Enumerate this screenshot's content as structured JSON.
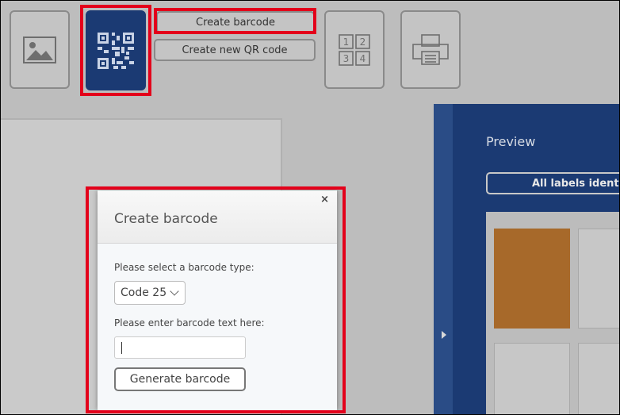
{
  "toolbar": {
    "create_barcode_label": "Create barcode",
    "create_qr_label": "Create new QR code",
    "tools": [
      {
        "name": "image-icon"
      },
      {
        "name": "qr-code-icon"
      },
      {
        "name": "label-order-icon",
        "digits": [
          "1",
          "2",
          "3",
          "4"
        ]
      },
      {
        "name": "print-layout-icon"
      }
    ]
  },
  "preview": {
    "title": "Preview",
    "all_labels_button": "All labels identical"
  },
  "dialog": {
    "title": "Create barcode",
    "close": "×",
    "type_prompt": "Please select a barcode type:",
    "type_selected": "Code 25",
    "text_prompt": "Please enter barcode text here:",
    "text_value": "",
    "generate_label": "Generate barcode"
  },
  "colors": {
    "accent_blue": "#1b3a73",
    "highlight_red": "#e3001b",
    "label_orange": "#a7692a"
  }
}
